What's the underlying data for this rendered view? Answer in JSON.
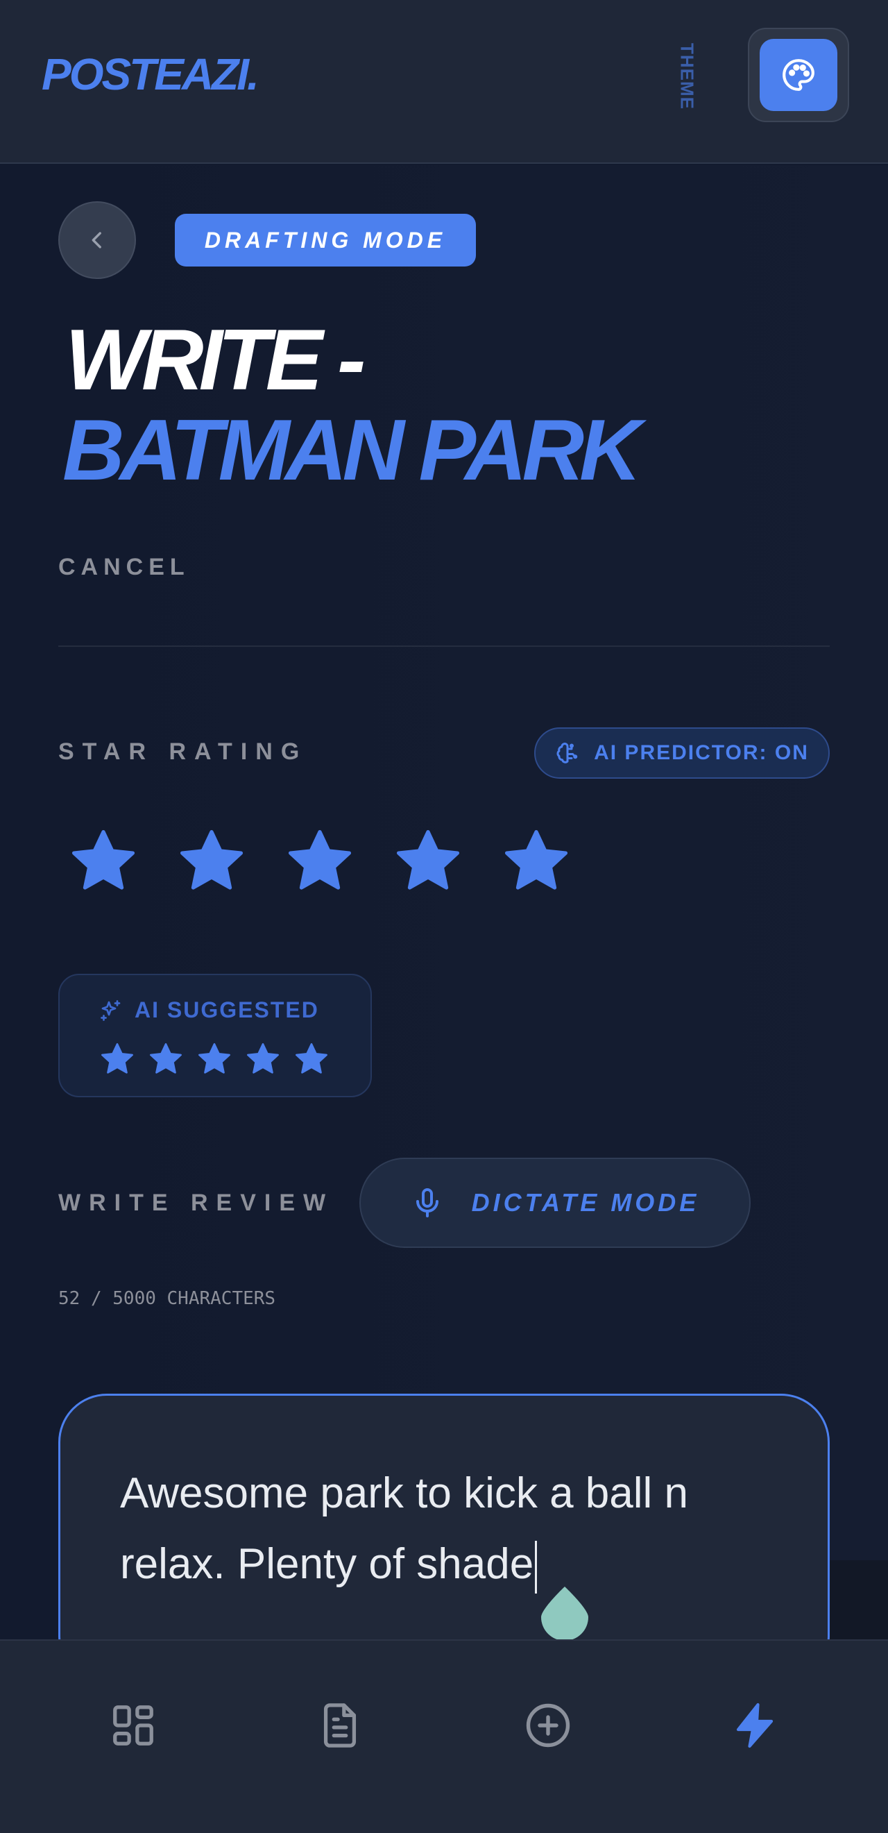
{
  "header": {
    "logo": "POSTEAZI.",
    "theme_label": "THEME"
  },
  "main": {
    "mode_badge": "DRAFTING MODE",
    "title_prefix": "WRITE -",
    "title_place": "BATMAN PARK",
    "cancel_label": "CANCEL",
    "star_rating_label": "STAR RATING",
    "ai_predictor_label": "AI PREDICTOR: ON",
    "rating": 5,
    "rating_max": 5,
    "ai_suggested_label": "AI SUGGESTED",
    "ai_suggested_rating": 5,
    "write_review_label": "WRITE REVIEW",
    "dictate_label": "DICTATE MODE",
    "char_count": "52 / 5000 CHARACTERS",
    "review_text": "Awesome park to kick a ball n relax. Plenty of shade"
  },
  "colors": {
    "accent": "#4c80ee",
    "background": "#121a2e",
    "surface": "#202839",
    "muted_text": "#8d909a",
    "caret_handle": "#8fc9bf"
  },
  "icons": {
    "theme": "palette-icon",
    "back": "chevron-left-icon",
    "ai_predictor": "brain-icon",
    "ai_suggested": "sparkles-icon",
    "dictate": "microphone-icon",
    "nav": [
      "grid-icon",
      "document-icon",
      "plus-circle-icon",
      "lightning-icon"
    ]
  },
  "bottom_nav": {
    "active_index": 3
  }
}
